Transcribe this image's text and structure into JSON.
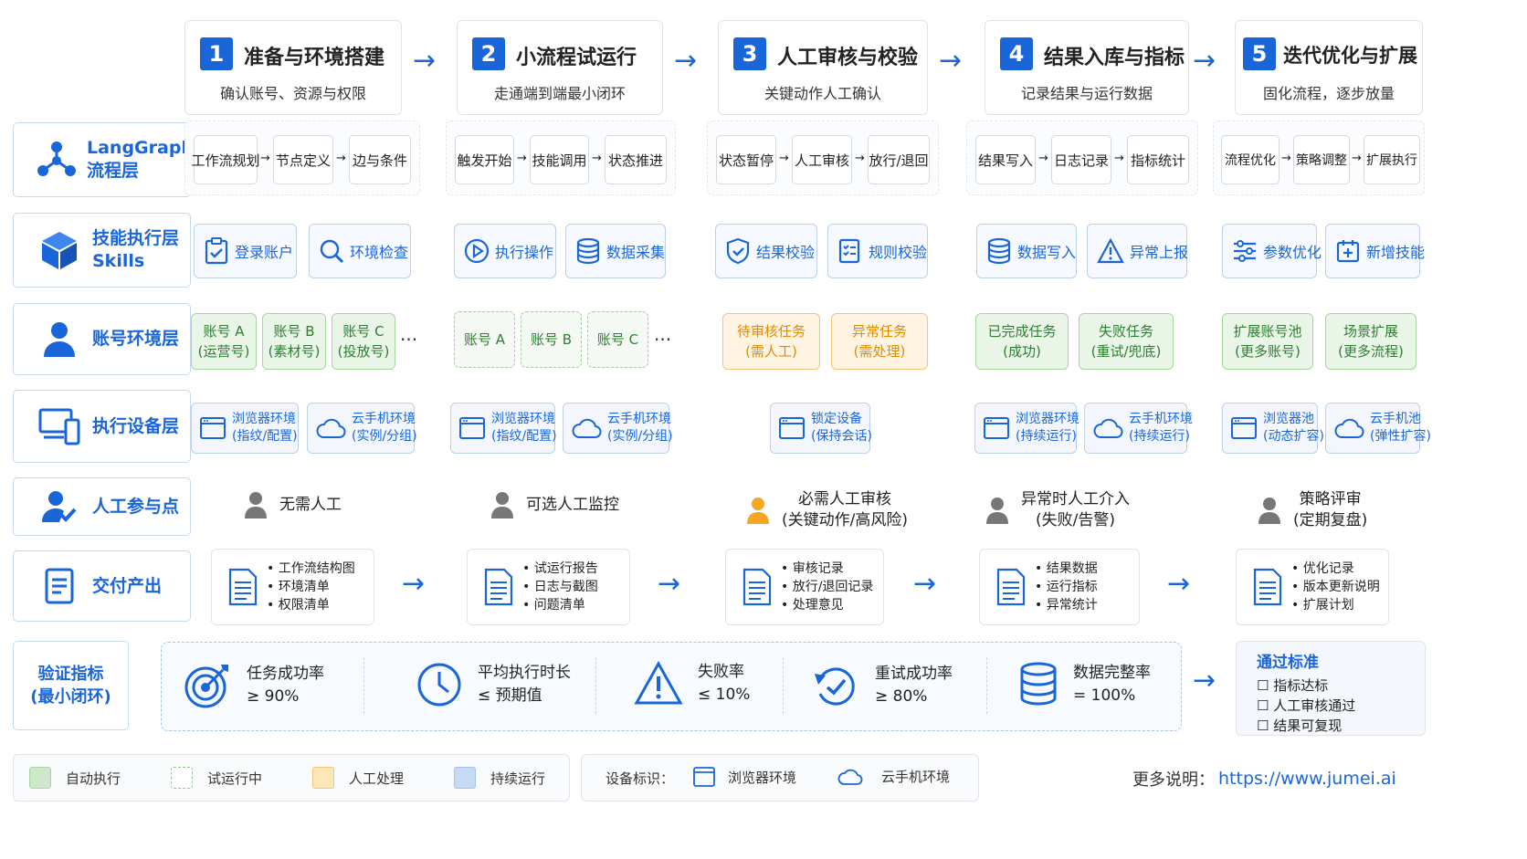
{
  "stages": [
    {
      "num": "1",
      "title": "准备与环境搭建",
      "sub": "确认账号、资源与权限"
    },
    {
      "num": "2",
      "title": "小流程试运行",
      "sub": "走通端到端最小闭环"
    },
    {
      "num": "3",
      "title": "人工审核与校验",
      "sub": "关键动作人工确认"
    },
    {
      "num": "4",
      "title": "结果入库与指标",
      "sub": "记录结果与运行数据"
    },
    {
      "num": "5",
      "title": "迭代优化与扩展",
      "sub": "固化流程，逐步放量"
    }
  ],
  "lanes": {
    "langgraph": {
      "line1": "LangGraph",
      "line2": "流程层"
    },
    "skills": {
      "line1": "技能执行层",
      "line2": "Skills"
    },
    "account": {
      "line1": "账号环境层"
    },
    "device": {
      "line1": "执行设备层"
    },
    "human": {
      "line1": "人工参与点"
    },
    "deliver": {
      "line1": "交付产出"
    },
    "verify": {
      "line1": "验证指标",
      "line2": "(最小闭环)"
    }
  },
  "flow_steps": [
    [
      "工作流规划",
      "节点定义",
      "边与条件"
    ],
    [
      "触发开始",
      "技能调用",
      "状态推进"
    ],
    [
      "状态暂停",
      "人工审核",
      "放行/退回"
    ],
    [
      "结果写入",
      "日志记录",
      "指标统计"
    ],
    [
      "流程优化",
      "策略调整",
      "扩展执行"
    ]
  ],
  "skills": [
    [
      {
        "label": "登录账户",
        "icon": "clipboard-check-icon"
      },
      {
        "label": "环境检查",
        "icon": "magnifier-icon"
      }
    ],
    [
      {
        "label": "执行操作",
        "icon": "play-icon"
      },
      {
        "label": "数据采集",
        "icon": "database-icon"
      }
    ],
    [
      {
        "label": "结果校验",
        "icon": "shield-check-icon"
      },
      {
        "label": "规则校验",
        "icon": "checklist-icon"
      }
    ],
    [
      {
        "label": "数据写入",
        "icon": "database-icon"
      },
      {
        "label": "异常上报",
        "icon": "warning-icon"
      }
    ],
    [
      {
        "label": "参数优化",
        "icon": "sliders-icon"
      },
      {
        "label": "新增技能",
        "icon": "calendar-plus-icon"
      }
    ]
  ],
  "accounts": {
    "s1": [
      {
        "l1": "账号 A",
        "l2": "(运营号)"
      },
      {
        "l1": "账号 B",
        "l2": "(素材号)"
      },
      {
        "l1": "账号 C",
        "l2": "(投放号)"
      }
    ],
    "s2": [
      "账号 A",
      "账号 B",
      "账号 C"
    ],
    "s3": [
      {
        "l1": "待审核任务",
        "l2": "(需人工)"
      },
      {
        "l1": "异常任务",
        "l2": "(需处理)"
      }
    ],
    "s4": [
      {
        "l1": "已完成任务",
        "l2": "(成功)"
      },
      {
        "l1": "失败任务",
        "l2": "(重试/兜底)"
      }
    ],
    "s5": [
      {
        "l1": "扩展账号池",
        "l2": "(更多账号)"
      },
      {
        "l1": "场景扩展",
        "l2": "(更多流程)"
      }
    ],
    "ellipsis": "···"
  },
  "devices": {
    "s1": [
      {
        "l1": "浏览器环境",
        "l2": "(指纹/配置)"
      },
      {
        "l1": "云手机环境",
        "l2": "(实例/分组)"
      }
    ],
    "s2": [
      {
        "l1": "浏览器环境",
        "l2": "(指纹/配置)"
      },
      {
        "l1": "云手机环境",
        "l2": "(实例/分组)"
      }
    ],
    "s3": [
      {
        "l1": "锁定设备",
        "l2": "(保持会话)"
      }
    ],
    "s4": [
      {
        "l1": "浏览器环境",
        "l2": "(持续运行)"
      },
      {
        "l1": "云手机环境",
        "l2": "(持续运行)"
      }
    ],
    "s5": [
      {
        "l1": "浏览器池",
        "l2": "(动态扩容)"
      },
      {
        "l1": "云手机池",
        "l2": "(弹性扩容)"
      }
    ]
  },
  "human": [
    {
      "l1": "无需人工",
      "l2": ""
    },
    {
      "l1": "可选人工监控",
      "l2": ""
    },
    {
      "l1": "必需人工审核",
      "l2": "(关键动作/高风险)"
    },
    {
      "l1": "异常时人工介入",
      "l2": "(失败/告警)"
    },
    {
      "l1": "策略评审",
      "l2": "(定期复盘)"
    }
  ],
  "deliverables": [
    [
      "• 工作流结构图",
      "• 环境清单",
      "• 权限清单"
    ],
    [
      "• 试运行报告",
      "• 日志与截图",
      "• 问题清单"
    ],
    [
      "• 审核记录",
      "• 放行/退回记录",
      "• 处理意见"
    ],
    [
      "• 结果数据",
      "• 运行指标",
      "• 异常统计"
    ],
    [
      "• 优化记录",
      "• 版本更新说明",
      "• 扩展计划"
    ]
  ],
  "metrics": [
    {
      "name": "任务成功率",
      "value": "≥ 90%"
    },
    {
      "name": "平均执行时长",
      "value": "≤ 预期值"
    },
    {
      "name": "失败率",
      "value": "≤ 10%"
    },
    {
      "name": "重试成功率",
      "value": "≥ 80%"
    },
    {
      "name": "数据完整率",
      "value": "= 100%"
    }
  ],
  "pass": {
    "title": "通过标准",
    "items": [
      "☐ 指标达标",
      "☐ 人工审核通过",
      "☐ 结果可复现"
    ]
  },
  "legend": {
    "items": [
      "自动执行",
      "试运行中",
      "人工处理",
      "持续运行"
    ],
    "device_label": "设备标识：",
    "browser": "浏览器环境",
    "cloud": "云手机环境",
    "more_label": "更多说明：",
    "url": "https://www.jumei.ai"
  },
  "arrow": "→",
  "colors": {
    "accent": "#1a66d9",
    "auto": "#cfe8cb",
    "human": "#fde7b8",
    "continuous": "#c7daf5"
  }
}
